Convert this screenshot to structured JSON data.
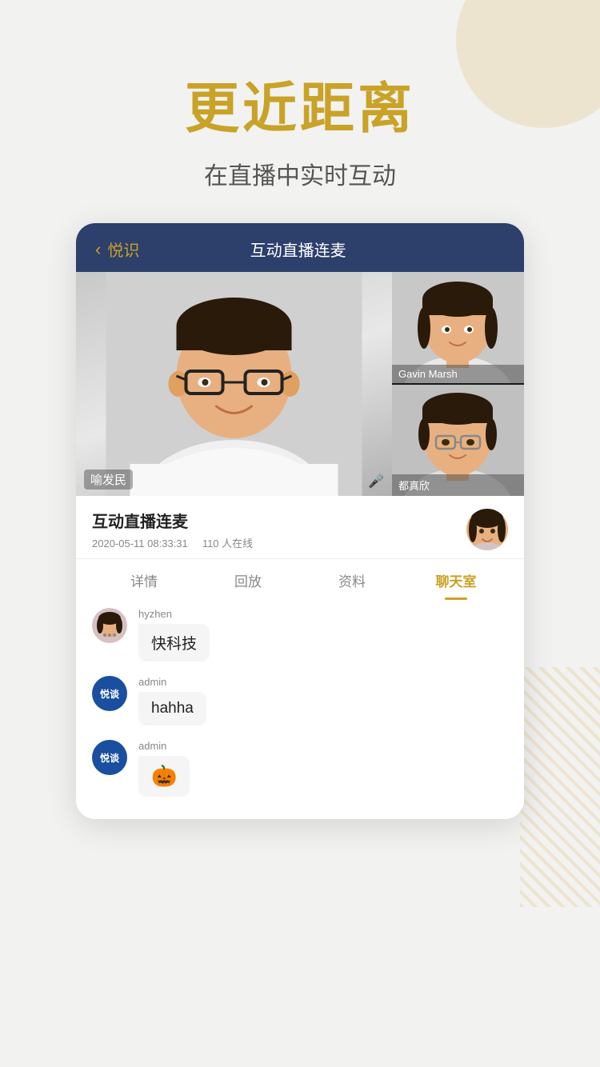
{
  "background": {
    "color": "#f2f2f0"
  },
  "header": {
    "main_title": "更近距离",
    "sub_title": "在直播中实时互动"
  },
  "phone": {
    "topbar": {
      "back_label": "悦识",
      "title": "互动直播连麦"
    },
    "video": {
      "main_person_name": "喻发民",
      "side_person1_name": "Gavin Marsh",
      "side_person2_name": "都真欣"
    },
    "info": {
      "title": "互动直播连麦",
      "date": "2020-05-11 08:33:31",
      "online_count": "110 人在线"
    },
    "tabs": [
      {
        "label": "详情",
        "active": false
      },
      {
        "label": "回放",
        "active": false
      },
      {
        "label": "资料",
        "active": false
      },
      {
        "label": "聊天室",
        "active": true
      }
    ],
    "chat": {
      "items": [
        {
          "user": "hyzhen",
          "avatar_type": "photo",
          "message": "快科技",
          "is_emoji": false
        },
        {
          "user": "admin",
          "avatar_type": "logo",
          "message": "hahha",
          "is_emoji": false
        },
        {
          "user": "admin",
          "avatar_type": "logo",
          "message": "🎃",
          "is_emoji": true
        }
      ]
    }
  },
  "icons": {
    "back_chevron": "‹",
    "mic": "🎤",
    "logo_text": "悦谈"
  }
}
